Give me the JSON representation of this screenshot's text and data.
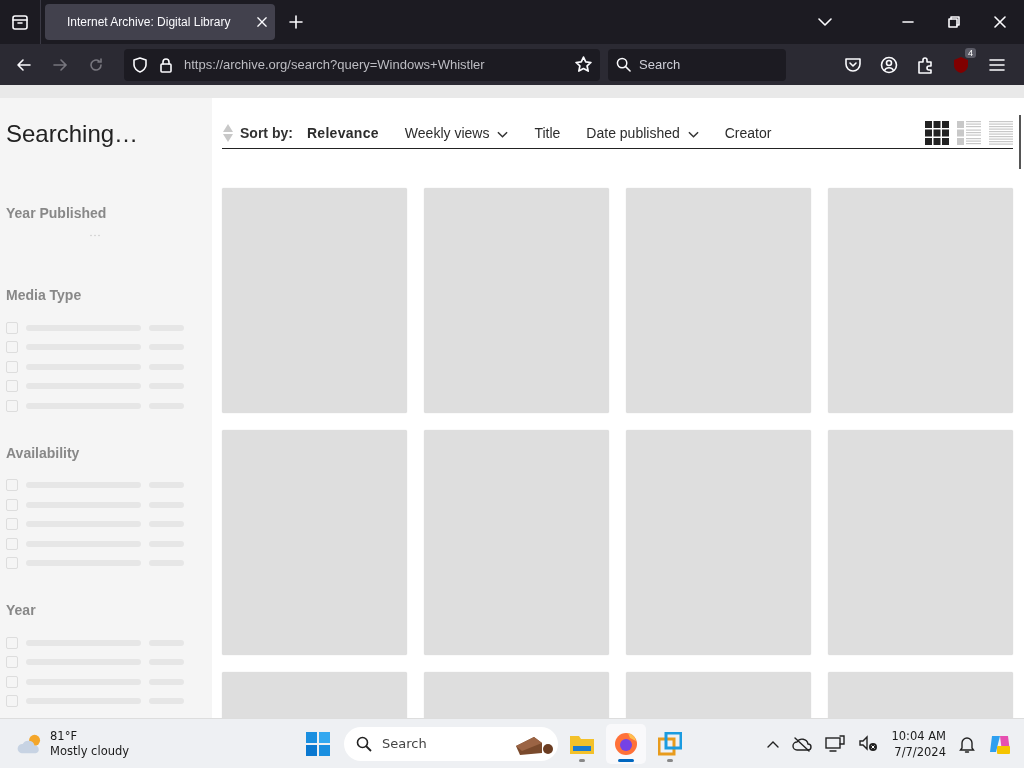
{
  "browser": {
    "tab": {
      "title": "Internet Archive: Digital Library",
      "selected": true
    },
    "address": "https://archive.org/search?query=Windows+Whistler",
    "search": {
      "placeholder": "Search"
    },
    "extension_badge": "4"
  },
  "sidebar": {
    "heading": "Searching…",
    "facets": [
      {
        "title": "Year Published",
        "kind": "histogram"
      },
      {
        "title": "Media Type",
        "kind": "checklist",
        "options": [
          {
            "checked": false
          },
          {
            "checked": false
          },
          {
            "checked": false
          },
          {
            "checked": false
          },
          {
            "checked": false
          }
        ]
      },
      {
        "title": "Availability",
        "kind": "checklist",
        "options": [
          {
            "checked": false
          },
          {
            "checked": false
          },
          {
            "checked": false
          },
          {
            "checked": false
          },
          {
            "checked": false
          }
        ]
      },
      {
        "title": "Year",
        "kind": "checklist",
        "options": [
          {
            "checked": false
          },
          {
            "checked": false
          },
          {
            "checked": false
          },
          {
            "checked": false
          }
        ]
      }
    ]
  },
  "sort_bar": {
    "label": "Sort by:",
    "options": [
      {
        "label": "Relevance",
        "selected": true,
        "dropdown": false
      },
      {
        "label": "Weekly views",
        "selected": false,
        "dropdown": true
      },
      {
        "label": "Title",
        "selected": false,
        "dropdown": false
      },
      {
        "label": "Date published",
        "selected": false,
        "dropdown": true
      },
      {
        "label": "Creator",
        "selected": false,
        "dropdown": false
      }
    ],
    "views": [
      {
        "kind": "grid",
        "selected": true
      },
      {
        "kind": "detail",
        "selected": false
      },
      {
        "kind": "compact",
        "selected": false
      }
    ]
  },
  "taskbar": {
    "weather": {
      "temperature": "81°F",
      "condition": "Mostly cloudy"
    },
    "search": {
      "placeholder": "Search"
    },
    "apps": [
      {
        "kind": "files",
        "active": false
      },
      {
        "kind": "firefox",
        "active": true
      },
      {
        "kind": "remote",
        "active": false
      }
    ],
    "clock": {
      "time": "10:04 AM",
      "date": "7/7/2024"
    }
  }
}
